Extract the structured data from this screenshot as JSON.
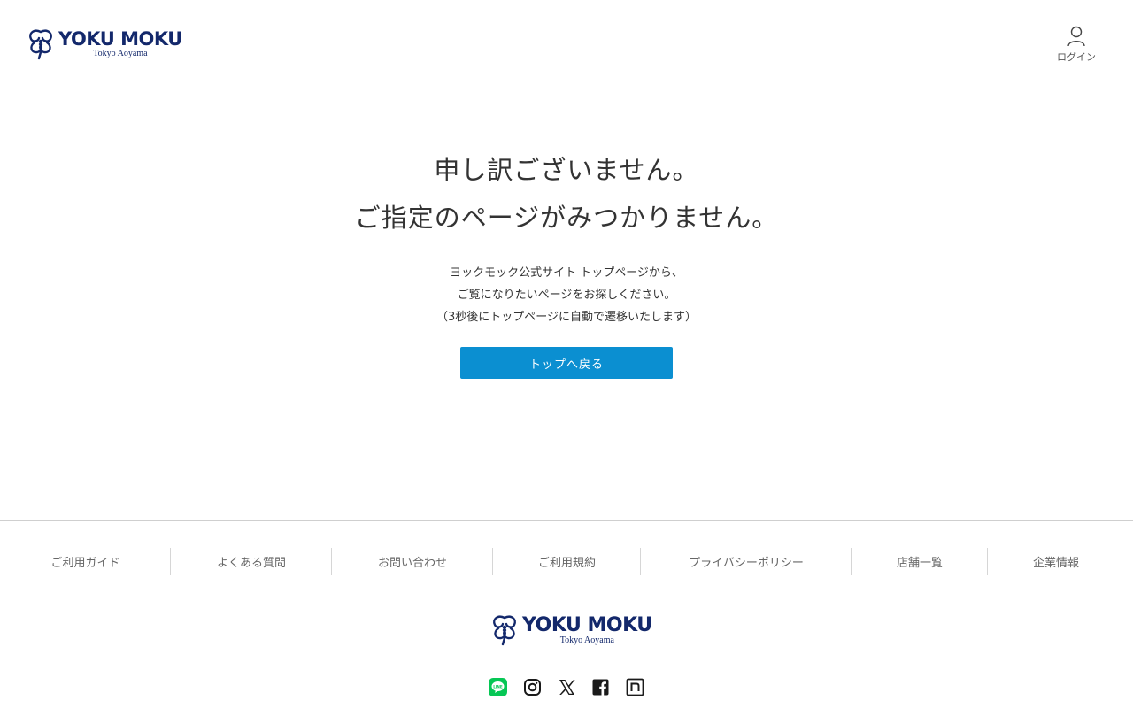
{
  "header": {
    "logo": {
      "brand": "YOKU MOKU",
      "sub": "Tokyo Aoyama"
    },
    "login_label": "ログイン"
  },
  "main": {
    "heading_line1": "申し訳ございません。",
    "heading_line2": "ご指定のページがみつかりません。",
    "desc_line1": "ヨックモック公式サイト トップページから、",
    "desc_line2": "ご覧になりたいページをお探しください。",
    "desc_line3": "（3秒後にトップページに自動で遷移いたします）",
    "button_label": "トップへ戻る"
  },
  "footer": {
    "nav": [
      {
        "label": "ご利用ガイド"
      },
      {
        "label": "よくある質問"
      },
      {
        "label": "お問い合わせ"
      },
      {
        "label": "ご利用規約"
      },
      {
        "label": "プライバシーポリシー"
      },
      {
        "label": "店舗一覧"
      },
      {
        "label": "企業情報"
      }
    ],
    "logo": {
      "brand": "YOKU MOKU",
      "sub": "Tokyo Aoyama"
    },
    "social": [
      {
        "icon": "line-icon",
        "color": "#06c755"
      },
      {
        "icon": "instagram-icon",
        "color": "#1a1a1a"
      },
      {
        "icon": "x-icon",
        "color": "#1a1a1a"
      },
      {
        "icon": "facebook-icon",
        "color": "#1a1a1a"
      },
      {
        "icon": "note-icon",
        "color": "#1a1a1a"
      }
    ]
  },
  "colors": {
    "brand_navy": "#13286b",
    "button_blue": "#0b8fd1"
  }
}
